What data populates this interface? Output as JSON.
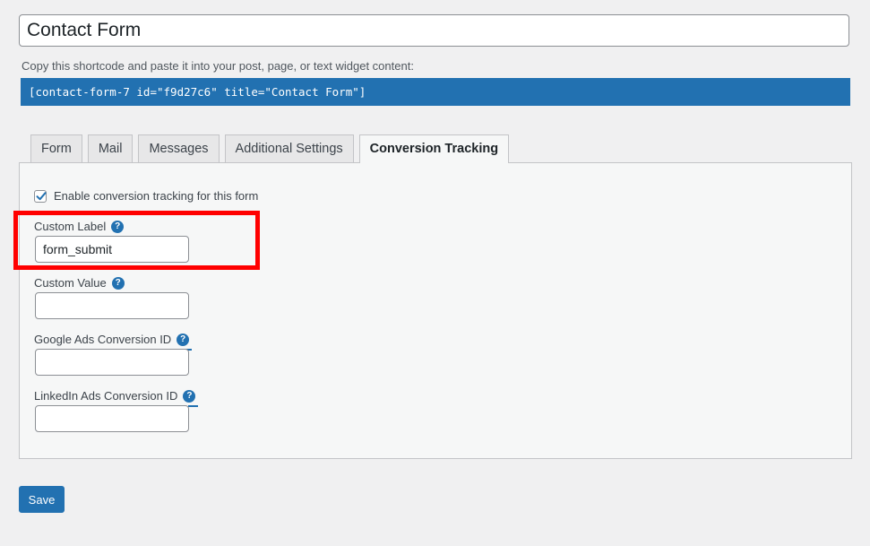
{
  "form": {
    "title_value": "Contact Form"
  },
  "shortcode": {
    "caption": "Copy this shortcode and paste it into your post, page, or text widget content:",
    "code": "[contact-form-7 id=\"f9d27c6\" title=\"Contact Form\"]"
  },
  "tabs": [
    {
      "label": "Form",
      "active": false
    },
    {
      "label": "Mail",
      "active": false
    },
    {
      "label": "Messages",
      "active": false
    },
    {
      "label": "Additional Settings",
      "active": false
    },
    {
      "label": "Conversion Tracking",
      "active": true
    }
  ],
  "conversion": {
    "enable_label": "Enable conversion tracking for this form",
    "enable_checked": true,
    "fields": [
      {
        "label": "Custom Label",
        "value": "form_submit"
      },
      {
        "label": "Custom Value",
        "value": ""
      },
      {
        "label": "Google Ads Conversion ID",
        "value": ""
      },
      {
        "label": "LinkedIn Ads Conversion ID",
        "value": ""
      }
    ],
    "help_glyph": "?"
  },
  "actions": {
    "save_label": "Save"
  },
  "icons": {
    "checkbox": "checkmark-icon",
    "help": "help-question-icon"
  },
  "colors": {
    "accent": "#2271b1",
    "highlight": "#ff0000",
    "background": "#f0f0f1"
  }
}
